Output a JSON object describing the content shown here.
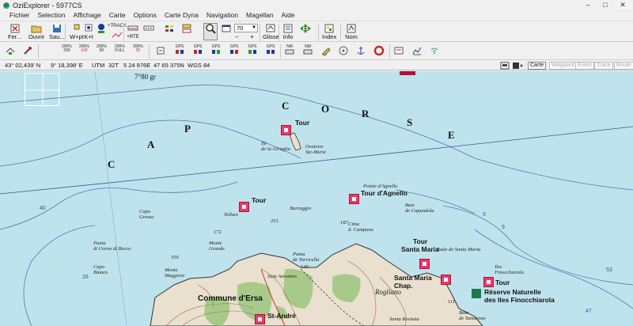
{
  "window": {
    "title": "OziExplorer - 5977CS",
    "minimize": "–",
    "maximize": "□",
    "close": "✕"
  },
  "menu": [
    "Fichier",
    "Selection",
    "Affichage",
    "Carte",
    "Options",
    "Carte Dyna",
    "Navigation",
    "Magellan",
    "Aide"
  ],
  "toolbar": {
    "fermer": "Fer...",
    "ouvrir": "Ouvrir",
    "sauver": "Sau...",
    "wpt": "W+pt",
    "kpt": "K+t",
    "zoom_value": "70",
    "glisse": "Glisse",
    "info": "Info",
    "index": "Index",
    "nom": "Nom",
    "track_label": "+TRACK",
    "route_label": "+RTE"
  },
  "toolbar2": {
    "zoom_items": [
      {
        "top": "200%",
        "bottom": "200"
      },
      {
        "top": "200%",
        "bottom": "100"
      },
      {
        "top": "200%",
        "bottom": "50"
      },
      {
        "top": "200%",
        "bottom": "FULL"
      },
      {
        "top": "200%",
        "bottom": "25"
      }
    ],
    "gps_items": [
      "GPS",
      "GPS",
      "GPS",
      "GPS",
      "GPS",
      "GPS",
      "GPS"
    ],
    "misc_items": [
      "NM",
      "NM"
    ]
  },
  "status": {
    "lat": "43° 02,439' N",
    "lon": "9° 18,398' E",
    "utm_label": "UTM",
    "utm_zone": "32T",
    "easting": "5 24 976E",
    "northing": "47 65 375N",
    "datum": "WGS 84",
    "btn_carte": "Carte",
    "btn_waypoint": "Waypoint",
    "btn_event": "Event",
    "btn_trace": "Trace",
    "btn_route": "Route"
  },
  "map": {
    "cap": [
      "C",
      "A",
      "P",
      "C",
      "O",
      "R",
      "S",
      "E"
    ],
    "magnetic": "7°80 gr",
    "labels": {
      "tour1": "Tour",
      "giraglia": "Ile\nde la Giraglia",
      "oratoire": "Oratoire\nSte-Marie",
      "tour_agnello": "Tour d'Agnello",
      "pointe_agnello": "Pointe d'Agnello",
      "tour2": "Tour",
      "tollare": "Tollare",
      "barcaggio": "Barcaggio",
      "capo_grosso": "Capo\nGrosso",
      "baie_capandola": "Baie\nde Capandola",
      "cima_campana": "Cima\nd. Campana",
      "tour3": "Tour",
      "santa_maria": "Santa Maria",
      "rade": "Rade de Santa Maria",
      "santa_maria_chap": "Santa Maria\nChap.",
      "iles": "Iles\nFinocchiarola",
      "tour4": "Tour",
      "reserve": "Réserve Naturelle\ndes Iles Finocchiarola",
      "pointe_corno": "Punta\ndi Corno di Becco",
      "capo_bianco": "Capo\nBianco",
      "commune": "Commune d'Ersa",
      "st_andre": "St-André",
      "monte_maggiore": "Monte\nMaggiore",
      "monte_grande": "Monte\nGrande",
      "rogliano": "Rogliano",
      "baie_tamarone": "Baie\nde Tamarone",
      "punta_torricella": "Punta\nde Torricella",
      "santa_resituta": "Santa Resituta",
      "sant_antonino": "Sant Antonino"
    },
    "depths": [
      "5",
      "9",
      "53",
      "26",
      "40",
      "47"
    ],
    "elevations": [
      "172",
      "359",
      "187",
      "111",
      "253",
      "130"
    ]
  }
}
